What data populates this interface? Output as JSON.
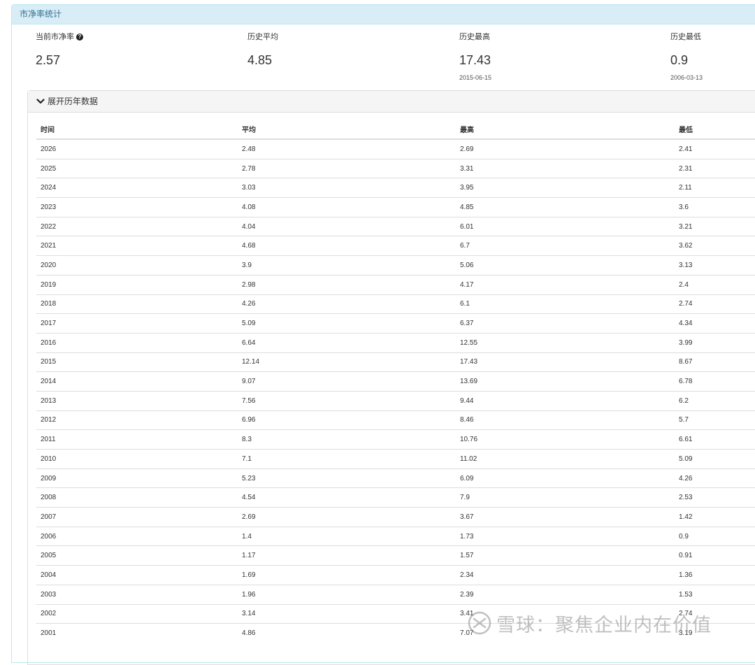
{
  "panel": {
    "title": "市净率统计"
  },
  "stats": [
    {
      "label": "当前市净率",
      "value": "2.57",
      "date": "",
      "help_icon": "question-circle-icon"
    },
    {
      "label": "历史平均",
      "value": "4.85",
      "date": ""
    },
    {
      "label": "历史最高",
      "value": "17.43",
      "date": "2015-06-15"
    },
    {
      "label": "历史最低",
      "value": "0.9",
      "date": "2006-03-13"
    }
  ],
  "history": {
    "toggle_label": "展开历年数据",
    "toggle_icon": "chevron-down-icon",
    "columns": [
      "时间",
      "平均",
      "最高",
      "最低"
    ],
    "rows": [
      [
        "2026",
        "2.48",
        "2.69",
        "2.41"
      ],
      [
        "2025",
        "2.78",
        "3.31",
        "2.31"
      ],
      [
        "2024",
        "3.03",
        "3.95",
        "2.11"
      ],
      [
        "2023",
        "4.08",
        "4.85",
        "3.6"
      ],
      [
        "2022",
        "4.04",
        "6.01",
        "3.21"
      ],
      [
        "2021",
        "4.68",
        "6.7",
        "3.62"
      ],
      [
        "2020",
        "3.9",
        "5.06",
        "3.13"
      ],
      [
        "2019",
        "2.98",
        "4.17",
        "2.4"
      ],
      [
        "2018",
        "4.26",
        "6.1",
        "2.74"
      ],
      [
        "2017",
        "5.09",
        "6.37",
        "4.34"
      ],
      [
        "2016",
        "6.64",
        "12.55",
        "3.99"
      ],
      [
        "2015",
        "12.14",
        "17.43",
        "8.67"
      ],
      [
        "2014",
        "9.07",
        "13.69",
        "6.78"
      ],
      [
        "2013",
        "7.56",
        "9.44",
        "6.2"
      ],
      [
        "2012",
        "6.96",
        "8.46",
        "5.7"
      ],
      [
        "2011",
        "8.3",
        "10.76",
        "6.61"
      ],
      [
        "2010",
        "7.1",
        "11.02",
        "5.09"
      ],
      [
        "2009",
        "5.23",
        "6.09",
        "4.26"
      ],
      [
        "2008",
        "4.54",
        "7.9",
        "2.53"
      ],
      [
        "2007",
        "2.69",
        "3.67",
        "1.42"
      ],
      [
        "2006",
        "1.4",
        "1.73",
        "0.9"
      ],
      [
        "2005",
        "1.17",
        "1.57",
        "0.91"
      ],
      [
        "2004",
        "1.69",
        "2.34",
        "1.36"
      ],
      [
        "2003",
        "1.96",
        "2.39",
        "1.53"
      ],
      [
        "2002",
        "3.14",
        "3.41",
        "2.74"
      ],
      [
        "2001",
        "4.86",
        "7.07",
        "3.19"
      ]
    ]
  },
  "watermark": {
    "text": "雪球：聚焦企业内在价值",
    "icon": "xueqiu-logo-icon"
  }
}
